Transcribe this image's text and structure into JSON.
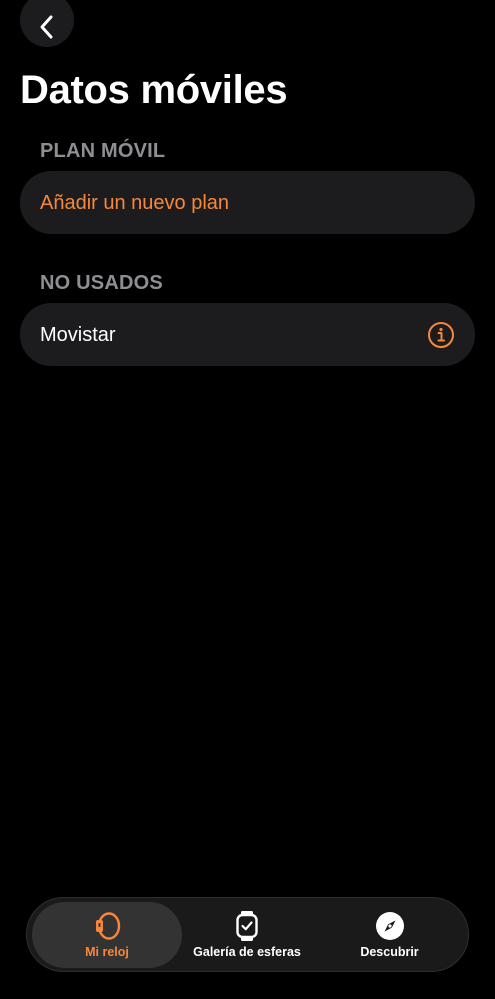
{
  "header": {
    "title": "Datos móviles"
  },
  "sections": {
    "plan": {
      "header": "PLAN MÓVIL",
      "add_plan_label": "Añadir un nuevo plan"
    },
    "unused": {
      "header": "NO USADOS",
      "carrier_label": "Movistar"
    }
  },
  "tab_bar": {
    "tabs": [
      {
        "label": "Mi reloj",
        "icon": "watch-side-icon",
        "active": true
      },
      {
        "label": "Galería de esferas",
        "icon": "watch-face-icon",
        "active": false
      },
      {
        "label": "Descubrir",
        "icon": "compass-icon",
        "active": false
      }
    ]
  },
  "colors": {
    "accent": "#f7883a",
    "background": "#000000",
    "row_background": "#1c1c1e",
    "section_header": "#8e8e93"
  }
}
